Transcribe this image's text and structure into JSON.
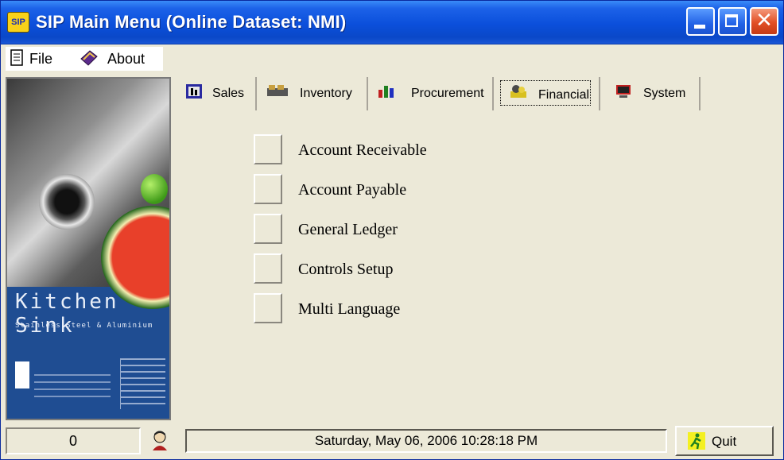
{
  "window": {
    "title": "SIP Main Menu (Online Dataset: NMI)",
    "app_icon_text": "SIP",
    "accent_color": "#0b4fdb"
  },
  "menu": {
    "file": "File",
    "about": "About"
  },
  "cover": {
    "title": "Kitchen Sink",
    "subtitle": "Stainless Steel & Aluminium"
  },
  "tabs": [
    {
      "label": "Sales",
      "icon": "sales-icon"
    },
    {
      "label": "Inventory",
      "icon": "inventory-icon"
    },
    {
      "label": "Procurement",
      "icon": "procurement-icon"
    },
    {
      "label": "Financial",
      "icon": "financial-icon",
      "active": true
    },
    {
      "label": "System",
      "icon": "system-icon"
    }
  ],
  "financial_menu": [
    "Account Receivable",
    "Account Payable",
    "General Ledger",
    "Controls Setup",
    "Multi Language"
  ],
  "status": {
    "count": "0",
    "datetime": "Saturday, May 06, 2006 10:28:18 PM",
    "quit_label": "Quit"
  }
}
